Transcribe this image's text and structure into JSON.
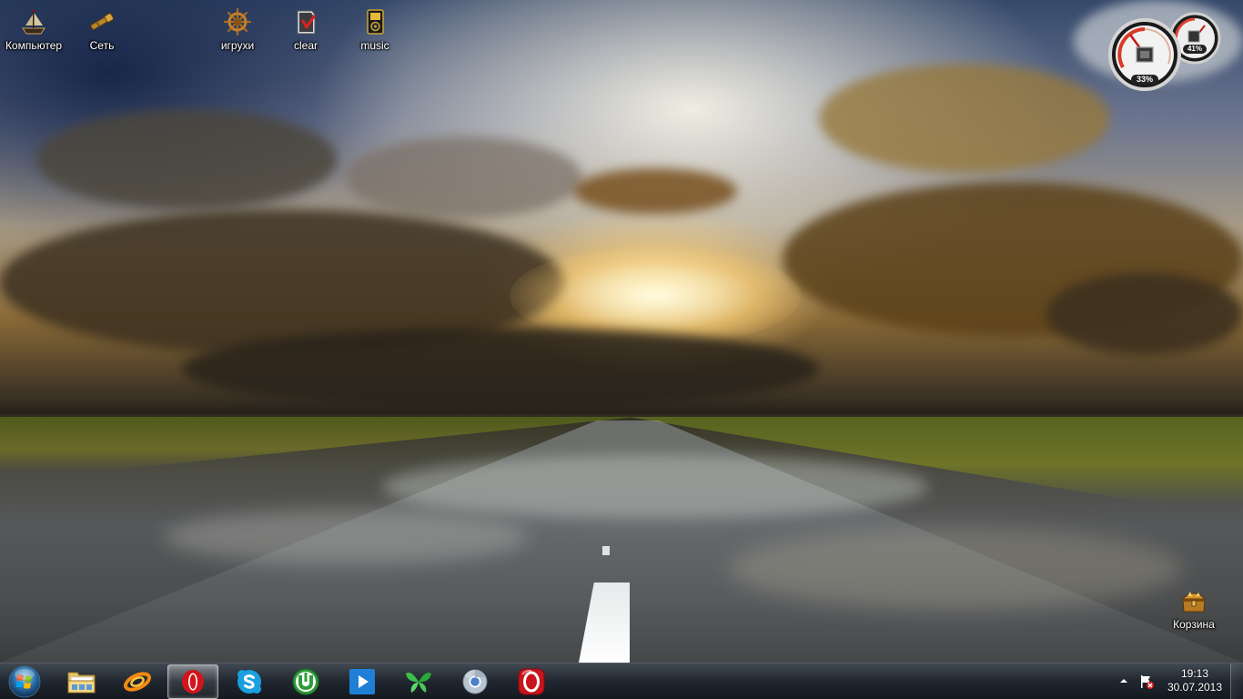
{
  "desktop": {
    "icons": [
      {
        "label": "Компьютер",
        "icon": "ship-icon"
      },
      {
        "label": "Сеть",
        "icon": "telescope-icon"
      },
      {
        "label": "игрухи",
        "icon": "ship-wheel-icon"
      },
      {
        "label": "clear",
        "icon": "recycle-clear-icon"
      },
      {
        "label": "music",
        "icon": "music-player-icon"
      },
      {
        "label": "Корзина",
        "icon": "treasure-chest-icon"
      }
    ]
  },
  "gadget": {
    "name": "cpu-meter-gadget",
    "cpu_usage": "33%",
    "memory_usage": "41%"
  },
  "taskbar": {
    "start_icon": "windows-logo-icon",
    "pinned": [
      {
        "name": "explorer",
        "icon": "folder-icon"
      },
      {
        "name": "browser-swirl",
        "icon": "swirl-icon"
      },
      {
        "name": "opera",
        "icon": "opera-icon",
        "active": true
      },
      {
        "name": "skype",
        "icon": "skype-icon"
      },
      {
        "name": "utorrent",
        "icon": "utorrent-icon"
      },
      {
        "name": "media-player",
        "icon": "play-icon"
      },
      {
        "name": "green-app",
        "icon": "green-butterfly-icon"
      },
      {
        "name": "chrome",
        "icon": "chrome-icon"
      },
      {
        "name": "opera-red",
        "icon": "red-o-icon"
      }
    ],
    "tray": {
      "time": "19:13",
      "date": "30.07.2013"
    }
  },
  "colors": {
    "taskbar": "#1e242c",
    "opera_red": "#d0161b",
    "skype_blue": "#1aa0e0",
    "utorrent_green": "#2e9b3a",
    "media_blue": "#1f7fd6"
  }
}
